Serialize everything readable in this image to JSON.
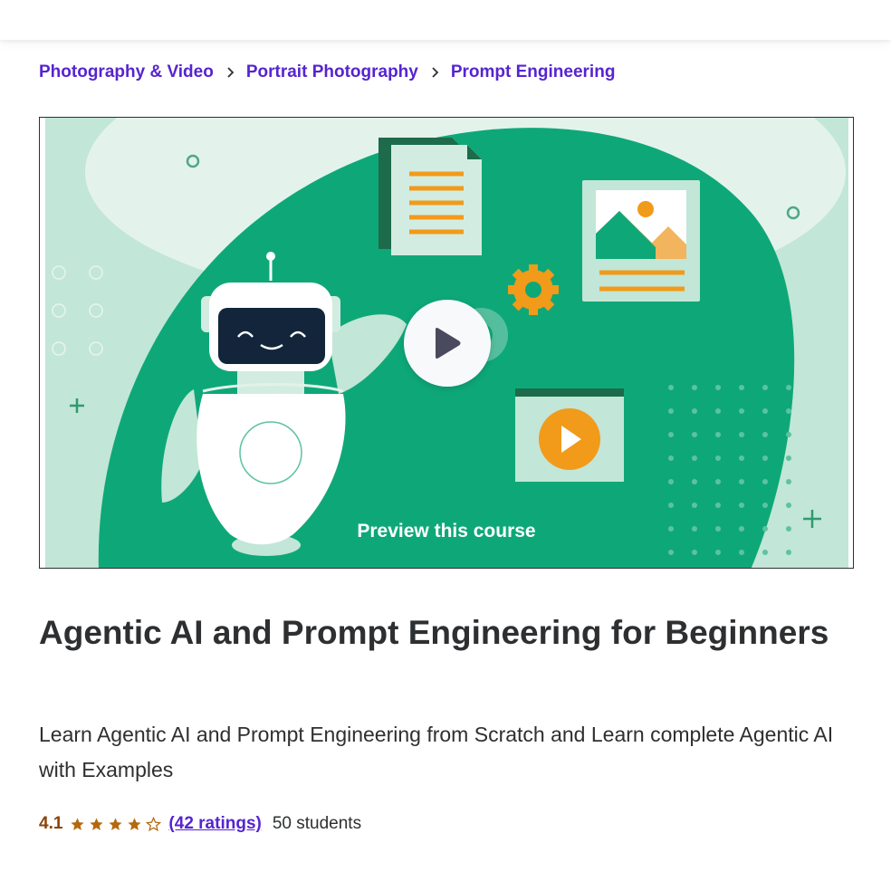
{
  "breadcrumb": {
    "items": [
      {
        "label": "Photography & Video"
      },
      {
        "label": "Portrait Photography"
      },
      {
        "label": "Prompt Engineering"
      }
    ],
    "separator_icon": "chevron-right-icon"
  },
  "preview": {
    "label": "Preview this course",
    "play_icon": "play-icon"
  },
  "course": {
    "title": "Agentic AI and Prompt Engineering for Beginners",
    "subtitle": "Learn Agentic AI and Prompt Engineering from Scratch and Learn complete Agentic AI with Examples",
    "rating": "4.1",
    "rating_stars": 4.1,
    "ratings_count": "(42 ratings)",
    "students": "50 students"
  },
  "colors": {
    "link_purple": "#5624d0",
    "rating_orange": "#8b4309",
    "star_orange": "#b4690e",
    "preview_green": "#0ea878",
    "preview_mint": "#c2e6d7",
    "accent_orange": "#f29a1a"
  }
}
